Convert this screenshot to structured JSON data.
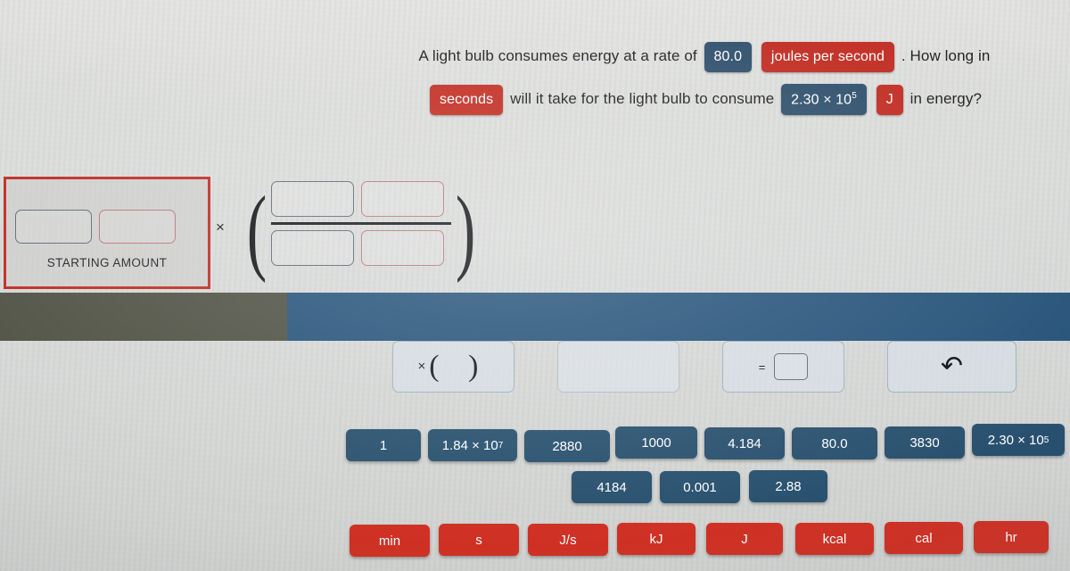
{
  "question": {
    "line1_part1": "A light bulb consumes energy at a rate of",
    "rate_value": "80.0",
    "rate_unit": "joules per second",
    "line1_part2": ". How long in",
    "time_unit": "seconds",
    "line2_part1": "will it take for the light bulb to consume",
    "energy_value_mantissa": "2.30 × 10",
    "energy_value_exponent": "5",
    "energy_unit": "J",
    "line2_part2": "in energy?"
  },
  "work_area": {
    "starting_amount_label": "STARTING AMOUNT",
    "starting_number_value": "",
    "starting_unit_value": "",
    "multiply_sign": "×",
    "fraction": {
      "numerator_number": "",
      "numerator_unit": "",
      "denominator_number": "",
      "denominator_unit": ""
    }
  },
  "operator_toolbar": {
    "multiply_label": "×",
    "multiply_parens": "(  )",
    "blank_label": "",
    "equals_sign": "=",
    "equals_box_value": "",
    "undo_glyph": "↶"
  },
  "number_tiles": {
    "row1": [
      {
        "label": "1",
        "exponent": ""
      },
      {
        "label": "1.84 × 10",
        "exponent": "7"
      },
      {
        "label": "2880",
        "exponent": ""
      },
      {
        "label": "1000",
        "exponent": ""
      },
      {
        "label": "4.184",
        "exponent": ""
      },
      {
        "label": "80.0",
        "exponent": ""
      },
      {
        "label": "3830",
        "exponent": ""
      },
      {
        "label": "2.30 × 10",
        "exponent": "5"
      }
    ],
    "row2": [
      {
        "label": "4184",
        "exponent": ""
      },
      {
        "label": "0.001",
        "exponent": ""
      },
      {
        "label": "2.88",
        "exponent": ""
      }
    ]
  },
  "unit_tiles": [
    {
      "label": "min"
    },
    {
      "label": "s"
    },
    {
      "label": "J/s"
    },
    {
      "label": "kJ"
    },
    {
      "label": "J"
    },
    {
      "label": "kcal"
    },
    {
      "label": "cal"
    },
    {
      "label": "hr"
    }
  ],
  "colors": {
    "number_tile": "#28506e",
    "unit_tile": "#cf3124",
    "starting_amount_border": "#bf2a21",
    "band_olive": "#4e5043",
    "band_blue": "#245178",
    "page_background": "#d8d9d6"
  }
}
